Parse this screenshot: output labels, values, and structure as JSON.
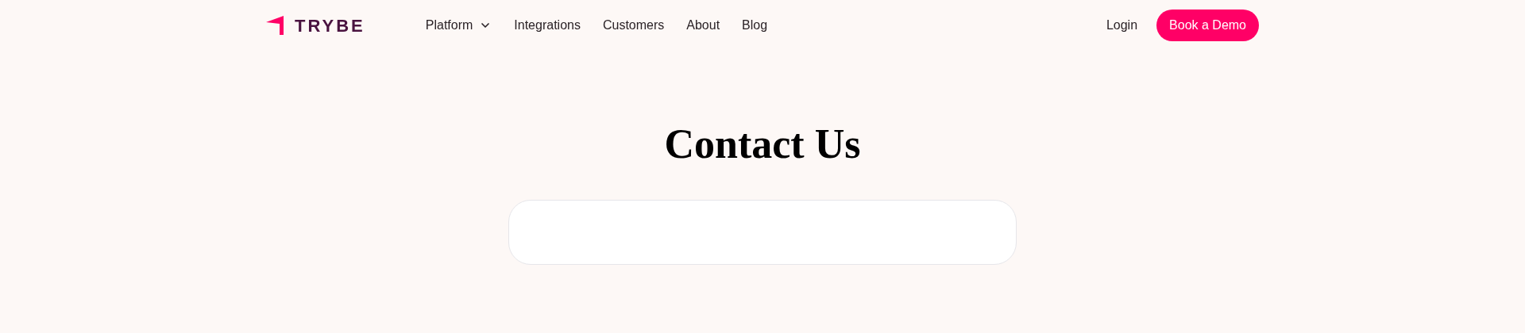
{
  "header": {
    "logo_text": "TRYBE",
    "nav": [
      {
        "label": "Platform",
        "kind": "dropdown"
      },
      {
        "label": "Integrations",
        "kind": "link"
      },
      {
        "label": "Customers",
        "kind": "link"
      },
      {
        "label": "About",
        "kind": "link"
      },
      {
        "label": "Blog",
        "kind": "link"
      }
    ],
    "login": "Login",
    "cta": "Book a Demo"
  },
  "main": {
    "title": "Contact Us",
    "form_card": {
      "kind": "empty"
    }
  }
}
